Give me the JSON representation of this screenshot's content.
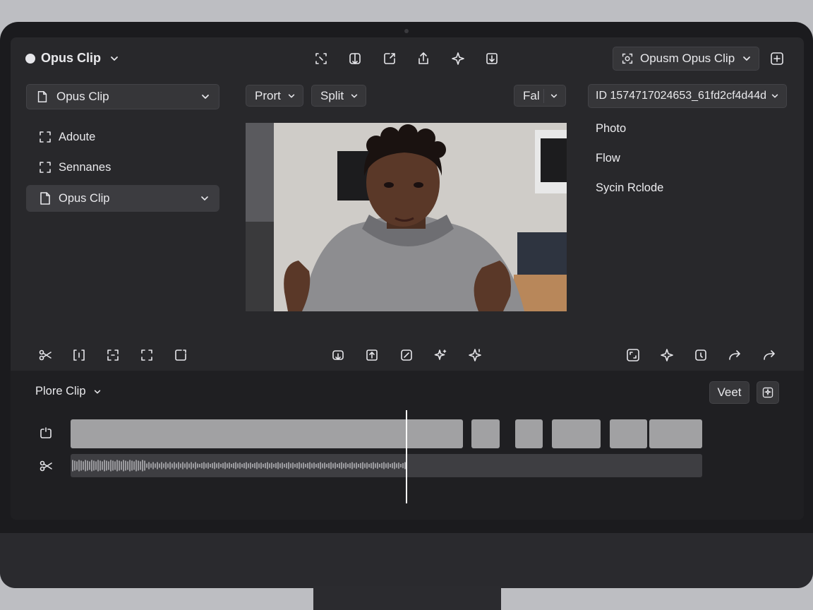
{
  "header": {
    "project_name": "Opus Clip",
    "account_label": "Opusm Opus Clip"
  },
  "left_panel": {
    "dropdown_label": "Opus Clip",
    "items": [
      {
        "label": "Adoute",
        "icon": "crop-frame-icon"
      },
      {
        "label": "Sennanes",
        "icon": "crop-frame-icon"
      },
      {
        "label": "Opus Clip",
        "icon": "document-icon"
      }
    ]
  },
  "toolbar": {
    "prort_label": "Prort",
    "split_label": "Split",
    "fal_label": "Fal",
    "id_label": "ID 1574717024653_61fd2cf4d44d"
  },
  "right_panel": {
    "items": [
      "Photo",
      "Flow",
      "Sycin Rclode"
    ]
  },
  "preview": {
    "description_icon": "video-preview"
  },
  "timeline": {
    "title": "Plore Clip",
    "veet_label": "Veet"
  },
  "colors": {
    "screen_bg": "#28282b",
    "timeline_bg": "#1f1f22",
    "clip_fill": "#a1a1a3",
    "playhead": "#ffffff"
  }
}
